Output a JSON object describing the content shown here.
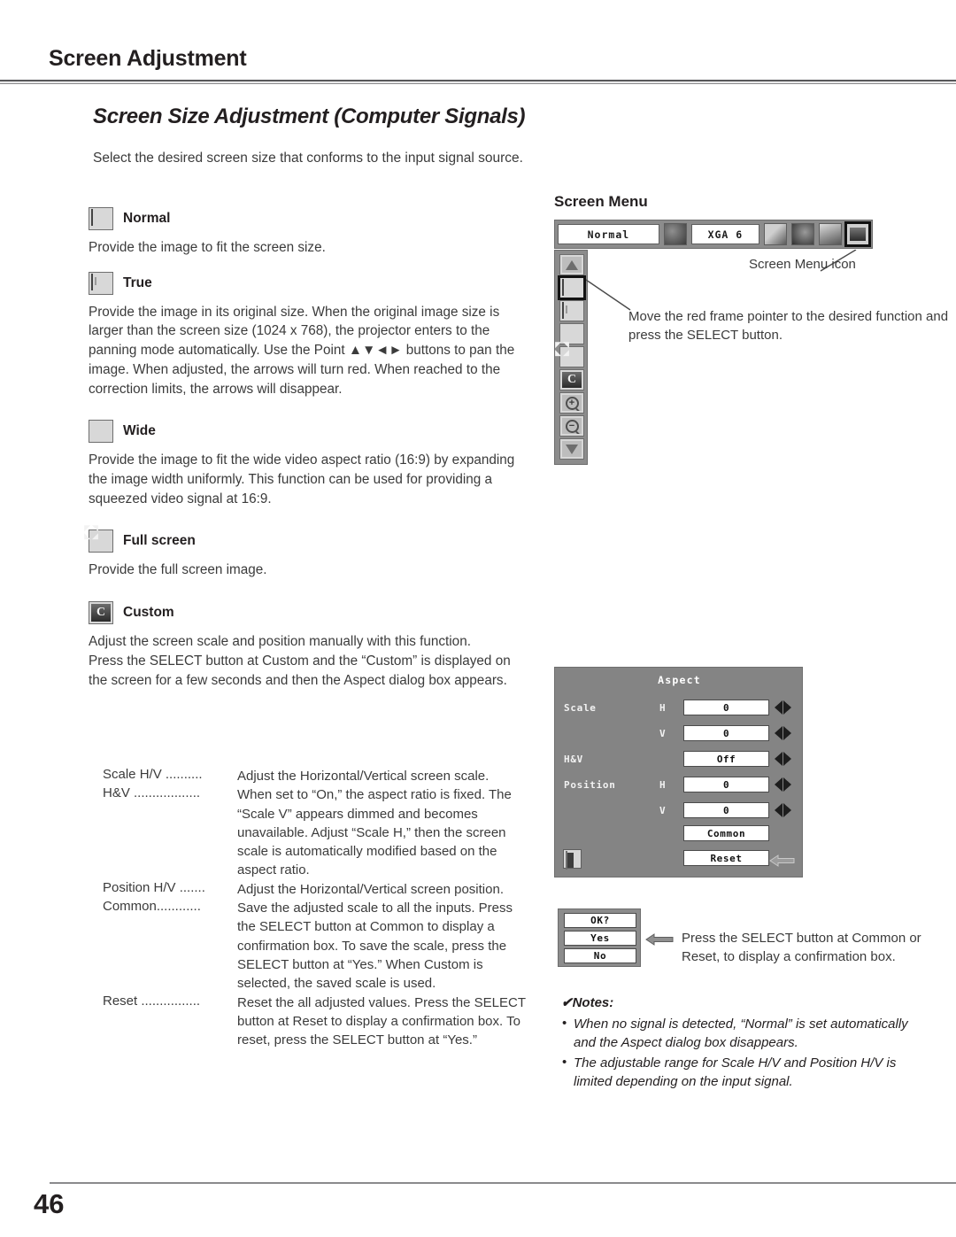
{
  "header": {
    "title": "Screen Adjustment"
  },
  "section": {
    "title": "Screen Size Adjustment (Computer Signals)",
    "intro": "Select the desired screen size that conforms to the input signal source."
  },
  "modes": [
    {
      "icon": "normal-screen-icon",
      "label": "Normal",
      "body": "Provide the image to fit the screen size."
    },
    {
      "icon": "true-screen-icon",
      "label": "True",
      "body": "Provide the image in its original size. When the original image size is larger than the screen size (1024 x 768), the projector enters to the panning mode automatically. Use the Point ▲▼◄► buttons to pan the image. When adjusted, the arrows will turn red. When reached to the correction limits, the arrows will disappear."
    },
    {
      "icon": "wide-screen-icon",
      "label": "Wide",
      "body": "Provide the image to fit the wide video aspect ratio (16:9) by expanding the image width uniformly. This function can be used for providing a squeezed video signal at 16:9."
    },
    {
      "icon": "full-screen-icon",
      "label": "Full screen",
      "body": "Provide the full screen image."
    },
    {
      "icon": "custom-screen-icon",
      "label": "Custom",
      "body": "Adjust the screen scale and position manually with this function.\nPress the SELECT button at Custom and the “Custom” is displayed on the screen for a few seconds and then the Aspect dialog box appears."
    }
  ],
  "definitions": [
    {
      "term": "Scale H/V ..........",
      "desc": "Adjust the Horizontal/Vertical screen scale."
    },
    {
      "term": "H&V ..................",
      "desc": "When set to “On,” the aspect ratio is fixed. The “Scale V” appears dimmed and becomes unavailable. Adjust “Scale H,” then the screen scale is automatically modified based on the aspect ratio."
    },
    {
      "term": "Position H/V .......",
      "desc": "Adjust the Horizontal/Vertical screen position."
    },
    {
      "term": "Common............",
      "desc": "Save the adjusted scale to all the inputs. Press the SELECT button at Common to display a confirmation box. To save the scale, press the SELECT button at “Yes.” When Custom is selected, the saved scale is used."
    },
    {
      "term": "Reset ................",
      "desc": "Reset the all adjusted values. Press the SELECT button at Reset to display a confirmation box. To reset, press the SELECT button at “Yes.”"
    }
  ],
  "screen_menu": {
    "title": "Screen Menu",
    "bar": {
      "mode_value": "Normal",
      "input_value": "XGA 6",
      "icons": [
        "projector-settings-icon",
        "computer-input-icon",
        "color-adjust-icon",
        "image-adjust-icon",
        "screen-menu-icon"
      ]
    },
    "icon_caption": "Screen Menu icon",
    "pointer_note": "Move the red frame pointer to the desired function and press the SELECT button.",
    "side_icons": [
      "scroll-up-icon",
      "normal-screen-icon",
      "true-screen-icon",
      "wide-screen-icon",
      "full-screen-icon",
      "custom-screen-icon",
      "zoom-in-icon",
      "zoom-out-icon",
      "scroll-down-icon"
    ]
  },
  "aspect_dialog": {
    "title": "Aspect",
    "rows": [
      {
        "label": "Scale",
        "axis": "H",
        "value": "0"
      },
      {
        "label": "",
        "axis": "V",
        "value": "0"
      },
      {
        "label": "H&V",
        "axis": "",
        "value": "Off"
      },
      {
        "label": "Position",
        "axis": "H",
        "value": "0"
      },
      {
        "label": "",
        "axis": "V",
        "value": "0"
      }
    ],
    "buttons": [
      "Common",
      "Reset"
    ],
    "exit_icon": "exit-door-icon",
    "back_icon": "back-arrow-icon"
  },
  "confirm_box": {
    "prompt": "OK?",
    "yes": "Yes",
    "no": "No",
    "note": "Press the SELECT button at Common or Reset, to display a confirmation box."
  },
  "notes": {
    "heading": "Notes:",
    "items": [
      "When no signal is detected, “Normal” is set automatically and the Aspect dialog box disappears.",
      "The adjustable range for Scale H/V and Position H/V is limited depending on the input signal."
    ]
  },
  "footer": {
    "page_number": "46"
  },
  "colors": {
    "osd_gray": "#8c8c8c",
    "dialog_gray": "#848484",
    "rule_gray": "#58585a",
    "text": "#3b3b3b"
  }
}
